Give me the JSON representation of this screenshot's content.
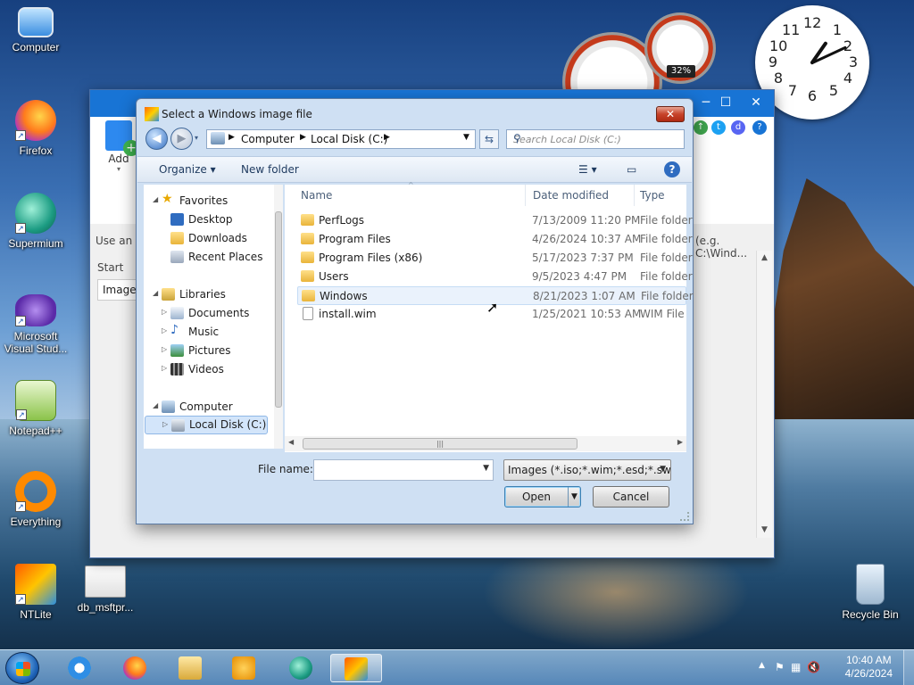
{
  "desktop": {
    "icons": [
      {
        "label": "Computer"
      },
      {
        "label": "Firefox"
      },
      {
        "label": "Supermium"
      },
      {
        "label": "Microsoft Visual Stud..."
      },
      {
        "label": "Notepad++"
      },
      {
        "label": "Everything"
      },
      {
        "label": "NTLite"
      },
      {
        "label": "db_msftpr..."
      },
      {
        "label": "Recycle Bin"
      }
    ],
    "gadget_cpu_percent": "32%"
  },
  "app_window": {
    "add_label": "Add",
    "hint_text": "Use an e",
    "hint_right": "(e.g. C:\\Wind...",
    "start_label": "Start",
    "image_label": "Image"
  },
  "dialog": {
    "title": "Select a Windows image file",
    "address": {
      "segments": [
        "Computer",
        "Local Disk (C:)"
      ]
    },
    "search_placeholder": "Search Local Disk (C:)",
    "toolbar": {
      "organize": "Organize",
      "new_folder": "New folder"
    },
    "nav": {
      "favorites": "Favorites",
      "favorites_items": [
        "Desktop",
        "Downloads",
        "Recent Places"
      ],
      "libraries": "Libraries",
      "library_items": [
        "Documents",
        "Music",
        "Pictures",
        "Videos"
      ],
      "computer": "Computer",
      "computer_items": [
        "Local Disk (C:)"
      ]
    },
    "columns": {
      "name": "Name",
      "date_modified": "Date modified",
      "type": "Type"
    },
    "files": [
      {
        "name": "PerfLogs",
        "date": "7/13/2009 11:20 PM",
        "type": "File folder"
      },
      {
        "name": "Program Files",
        "date": "4/26/2024 10:37 AM",
        "type": "File folder"
      },
      {
        "name": "Program Files (x86)",
        "date": "5/17/2023 7:37 PM",
        "type": "File folder"
      },
      {
        "name": "Users",
        "date": "9/5/2023 4:47 PM",
        "type": "File folder"
      },
      {
        "name": "Windows",
        "date": "8/21/2023 1:07 AM",
        "type": "File folder"
      },
      {
        "name": "install.wim",
        "date": "1/25/2021 10:53 AM",
        "type": "WIM File"
      }
    ],
    "file_name_label": "File name:",
    "file_name_value": "",
    "filter": "Images (*.iso;*.wim;*.esd;*.swm",
    "open_label": "Open",
    "cancel_label": "Cancel"
  },
  "taskbar": {
    "time": "10:40 AM",
    "date": "4/26/2024"
  }
}
